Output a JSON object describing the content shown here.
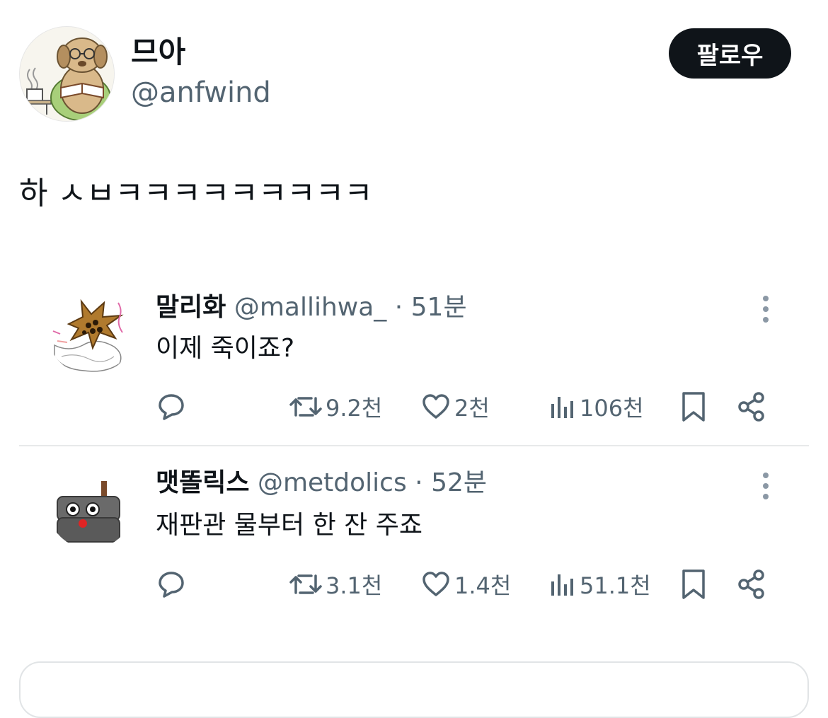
{
  "tweet": {
    "author": {
      "display_name": "므아",
      "handle": "@anfwind"
    },
    "follow_label": "팔로우",
    "text": "하 ㅅㅂㅋㅋㅋㅋㅋㅋㅋㅋㅋ"
  },
  "replies": [
    {
      "name": "말리화",
      "handle": "@mallihwa_",
      "separator": "·",
      "time": "51분",
      "text": "이제 죽이죠?",
      "retweets": "9.2천",
      "likes": "2천",
      "views": "106천"
    },
    {
      "name": "맷똘릭스",
      "handle": "@metdolics",
      "separator": "·",
      "time": "52분",
      "text": "재판관 물부터 한 잔 주죠",
      "retweets": "3.1천",
      "likes": "1.4천",
      "views": "51.1천"
    }
  ],
  "colors": {
    "text_primary": "#0f1419",
    "text_secondary": "#536471",
    "button_bg": "#0f1419",
    "divider": "#e7e9ea"
  },
  "icons": {
    "reply": "speech-bubble-icon",
    "retweet": "retweet-icon",
    "like": "heart-icon",
    "views": "bar-chart-icon",
    "bookmark": "bookmark-icon",
    "share": "share-icon",
    "more": "more-vertical-icon"
  }
}
